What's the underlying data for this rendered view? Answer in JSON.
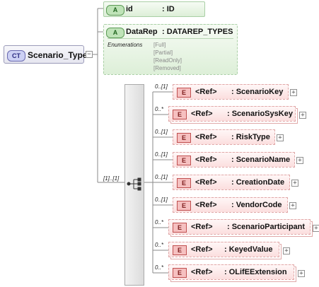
{
  "complex_type": {
    "badge": "CT",
    "name": "Scenario_Type"
  },
  "attributes": [
    {
      "badge": "A",
      "name": "id",
      "type": ": ID"
    },
    {
      "badge": "A",
      "name": "DataRep",
      "type": ": DATAREP_TYPES",
      "enumerations_label": "Enumerations",
      "enumerations": [
        "[Full]",
        "[Partial]",
        "[ReadOnly]",
        "[Removed]"
      ]
    }
  ],
  "sequence": {
    "cardinality": "[1]..[1]"
  },
  "elements": [
    {
      "cardinality": "0..[1]",
      "badge": "E",
      "ref": "<Ref>",
      "name": ": ScenarioKey"
    },
    {
      "cardinality": "0..*",
      "badge": "E",
      "ref": "<Ref>",
      "name": ": ScenarioSysKey"
    },
    {
      "cardinality": "0..[1]",
      "badge": "E",
      "ref": "<Ref>",
      "name": ": RiskType"
    },
    {
      "cardinality": "0..[1]",
      "badge": "E",
      "ref": "<Ref>",
      "name": ": ScenarioName"
    },
    {
      "cardinality": "0..[1]",
      "badge": "E",
      "ref": "<Ref>",
      "name": ": CreationDate"
    },
    {
      "cardinality": "0..[1]",
      "badge": "E",
      "ref": "<Ref>",
      "name": ": VendorCode"
    },
    {
      "cardinality": "0..*",
      "badge": "E",
      "ref": "<Ref>",
      "name": ": ScenarioParticipant"
    },
    {
      "cardinality": "0..*",
      "badge": "E",
      "ref": "<Ref>",
      "name": ": KeyedValue"
    },
    {
      "cardinality": "0..*",
      "badge": "E",
      "ref": "<Ref>",
      "name": ": OLifEExtension"
    }
  ]
}
